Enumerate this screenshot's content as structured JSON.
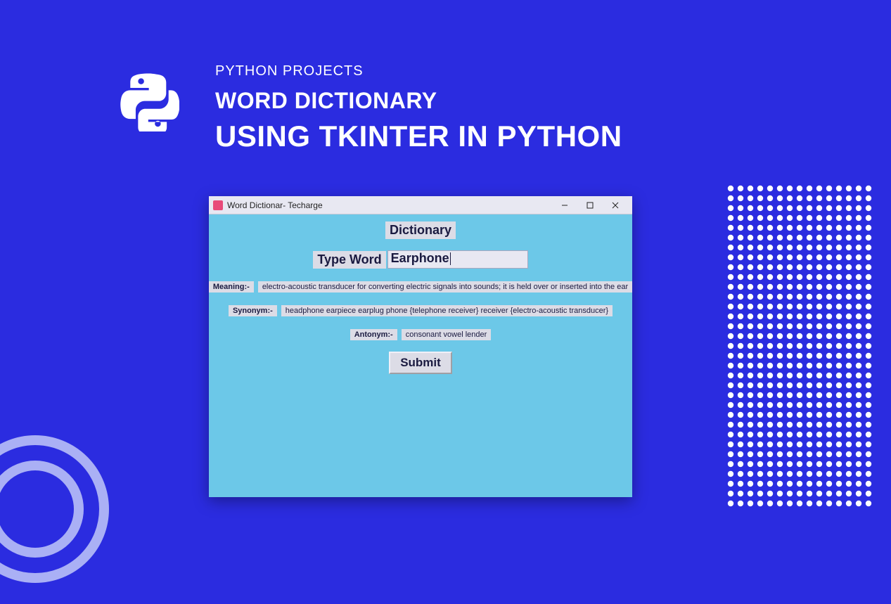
{
  "header": {
    "eyebrow": "PYTHON PROJECTS",
    "line1": "WORD DICTIONARY",
    "line2": "USING TKINTER IN PYTHON"
  },
  "window": {
    "title": "Word Dictionar- Techarge",
    "heading": "Dictionary",
    "type_word_label": "Type Word",
    "entry_value": "Earphone",
    "meaning_label": "Meaning:-",
    "meaning_value": "electro-acoustic transducer for converting electric signals into sounds; it is held over or inserted into the ear",
    "synonym_label": "Synonym:-",
    "synonym_value": "headphone earpiece earplug phone {telephone receiver} receiver {electro-acoustic transducer}",
    "antonym_label": "Antonym:-",
    "antonym_value": "consonant vowel lender",
    "submit_label": "Submit"
  }
}
